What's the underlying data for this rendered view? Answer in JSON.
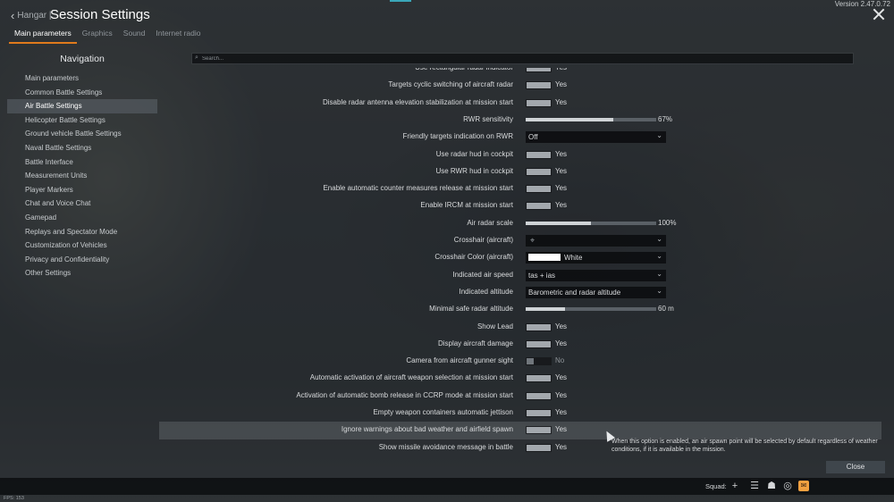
{
  "header": {
    "back_label": "Hangar |",
    "title": "Session Settings",
    "version": "Version 2.47.0.72"
  },
  "tabs": [
    {
      "label": "Main parameters",
      "active": true
    },
    {
      "label": "Graphics",
      "active": false
    },
    {
      "label": "Sound",
      "active": false
    },
    {
      "label": "Internet radio",
      "active": false
    }
  ],
  "navigation": {
    "title": "Navigation",
    "items": [
      {
        "label": "Main parameters"
      },
      {
        "label": "Common Battle Settings"
      },
      {
        "label": "Air Battle Settings",
        "active": true
      },
      {
        "label": "Helicopter Battle Settings"
      },
      {
        "label": "Ground vehicle Battle Settings"
      },
      {
        "label": "Naval Battle Settings"
      },
      {
        "label": "Battle Interface"
      },
      {
        "label": "Measurement Units"
      },
      {
        "label": "Player Markers"
      },
      {
        "label": "Chat and Voice Chat"
      },
      {
        "label": "Gamepad"
      },
      {
        "label": "Replays and Spectator Mode"
      },
      {
        "label": "Customization of Vehicles"
      },
      {
        "label": "Privacy and Confidentiality"
      },
      {
        "label": "Other Settings"
      }
    ]
  },
  "search": {
    "placeholder": "Search..."
  },
  "settings": [
    {
      "label": "Use rectangular radar indicator",
      "type": "toggle",
      "value": "Yes"
    },
    {
      "label": "Targets cyclic switching of aircraft radar",
      "type": "toggle",
      "value": "Yes"
    },
    {
      "label": "Disable radar antenna elevation stabilization at mission start",
      "type": "toggle",
      "value": "Yes"
    },
    {
      "label": "RWR sensitivity",
      "type": "slider",
      "value": "67%",
      "level": 0.67
    },
    {
      "label": "Friendly targets indication on RWR",
      "type": "select",
      "value": "Off"
    },
    {
      "label": "Use radar hud in cockpit",
      "type": "toggle",
      "value": "Yes"
    },
    {
      "label": "Use RWR hud in cockpit",
      "type": "toggle",
      "value": "Yes"
    },
    {
      "label": "Enable automatic counter measures release at mission start",
      "type": "toggle",
      "value": "Yes"
    },
    {
      "label": "Enable IRCM at mission start",
      "type": "toggle",
      "value": "Yes"
    },
    {
      "label": "Air radar scale",
      "type": "slider",
      "value": "100%",
      "level": 0.5
    },
    {
      "label": "Crosshair (aircraft)",
      "type": "select-crosshair",
      "value": ""
    },
    {
      "label": "Crosshair Color (aircraft)",
      "type": "select-color",
      "value": "White",
      "color": "#ffffff"
    },
    {
      "label": "Indicated air speed",
      "type": "select",
      "value": "tas + ias"
    },
    {
      "label": "Indicated altitude",
      "type": "select",
      "value": "Barometric and radar altitude"
    },
    {
      "label": "Minimal safe radar altitude",
      "type": "slider",
      "value": "60 m",
      "level": 0.3
    },
    {
      "label": "Show Lead",
      "type": "toggle",
      "value": "Yes"
    },
    {
      "label": "Display aircraft damage",
      "type": "toggle",
      "value": "Yes"
    },
    {
      "label": "Camera from aircraft gunner sight",
      "type": "toggle-off",
      "value": "No"
    },
    {
      "label": "Automatic activation of aircraft weapon selection at mission start",
      "type": "toggle",
      "value": "Yes"
    },
    {
      "label": "Activation of automatic bomb release in CCRP mode at mission start",
      "type": "toggle",
      "value": "Yes"
    },
    {
      "label": "Empty weapon containers automatic jettison",
      "type": "toggle",
      "value": "Yes"
    },
    {
      "label": "Ignore warnings about bad weather and airfield spawn",
      "type": "toggle",
      "value": "Yes",
      "highlight": true
    },
    {
      "label": "Show missile avoidance message in battle",
      "type": "toggle",
      "value": "Yes"
    }
  ],
  "tooltip": "When this option is enabled, an air spawn point will be selected by default regardless of weather conditions, if it is available in the mission.",
  "footer": {
    "close_label": "Close",
    "squad_label": "Squad:",
    "fps": "FPS: 153"
  },
  "colors": {
    "accent": "#e07a1c",
    "top_accent": "#3aa7b9",
    "mail": "#f0a040"
  }
}
